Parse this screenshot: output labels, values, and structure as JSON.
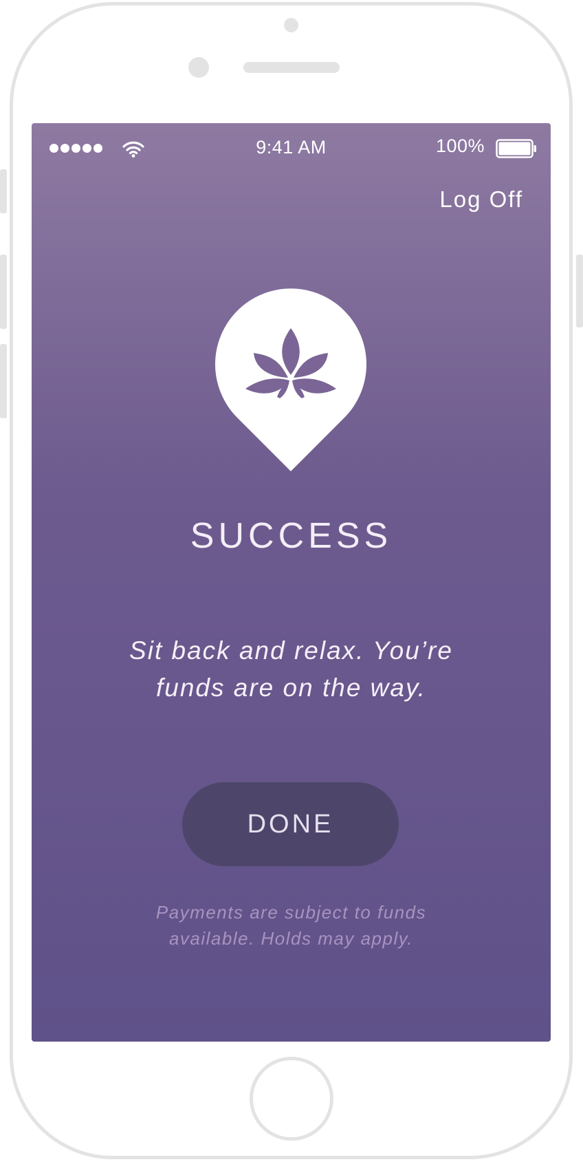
{
  "status_bar": {
    "time": "9:41 AM",
    "battery_percent": "100%",
    "signal_icon": "signal-dots-icon",
    "wifi_icon": "wifi-icon",
    "battery_icon": "battery-icon",
    "battery_level": 1.0
  },
  "header": {
    "log_off_label": "Log Off"
  },
  "badge": {
    "icon": "leaf-pin-icon"
  },
  "main": {
    "title": "SUCCESS",
    "message_lines": [
      "Sit back and relax. You’re",
      "funds are on the way."
    ],
    "done_label": "DONE",
    "disclaimer_lines": [
      "Payments are subject to funds",
      "available. Holds may apply."
    ]
  },
  "colors": {
    "gradient_top": "#8e7aa1",
    "gradient_bottom": "#5f5189",
    "button_bg": "#4d466a",
    "disclaimer_text": "#a993bf"
  }
}
